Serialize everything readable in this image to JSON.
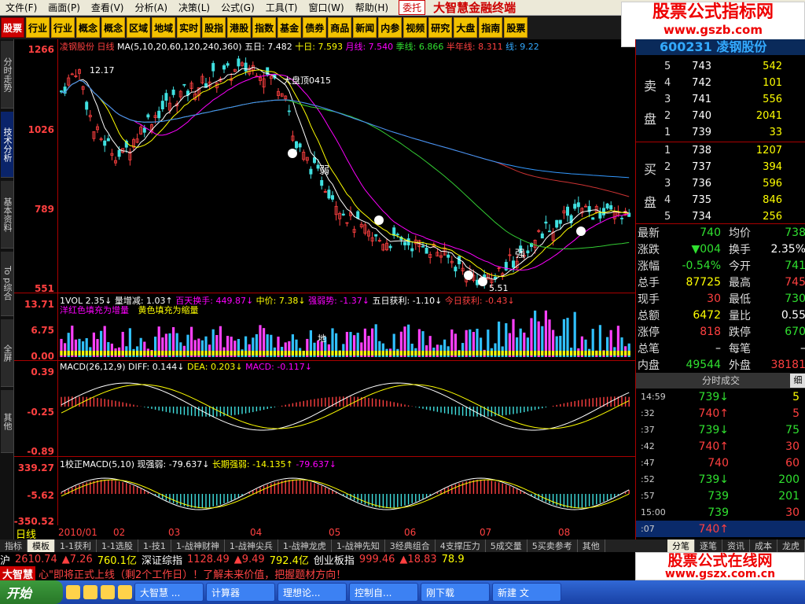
{
  "menu": [
    "文件(F)",
    "画面(P)",
    "查看(V)",
    "分析(A)",
    "决策(L)",
    "公式(G)",
    "工具(T)",
    "窗口(W)",
    "帮助(H)"
  ],
  "delegate": "委托",
  "brand": "大智慧金融终端",
  "toolbar": [
    "股票",
    "行业",
    "行业",
    "概念",
    "概念",
    "区域",
    "地域",
    "实时",
    "股指",
    "港股",
    "指数",
    "基金",
    "债券",
    "商品",
    "新闻",
    "内参",
    "视频",
    "研究",
    "大盘",
    "指南",
    "股票"
  ],
  "watermark": {
    "title": "股票公式指标网",
    "url": "www.gszb.com"
  },
  "watermark2": {
    "title": "股票公式在线网",
    "url": "www.gszx.com.cn"
  },
  "left_tabs": [
    "分时走势",
    "技术分析",
    "基本资料",
    "To p综合",
    "全屏",
    "其他"
  ],
  "stock_title": "凌钢股份 日线",
  "ma_line": {
    "label": "MA(5,10,20,60,120,240,360)",
    "items": [
      "五日: 7.482",
      "十日: 7.593",
      "月线: 7.540",
      "季线: 6.866",
      "半年线: 8.311",
      "线: 9.22"
    ]
  },
  "price_axis": [
    "1266",
    "1026",
    "789",
    "551"
  ],
  "annotations": {
    "peak_left": "12.17",
    "top_label": "大盘顶0415",
    "low_label": "5.51",
    "weak": "弱",
    "strong": "强",
    "di": "地"
  },
  "vol": {
    "title": "1VOL 2.35↓",
    "items": [
      "量增减: 1.03↑",
      "百天换手: 449.87↓",
      "中价: 7.38↓",
      "强弱势: -1.37↓",
      "五日获利: -1.10↓",
      "今日获利: -0.43↓"
    ],
    "legend_red": "洋红色填充为增量",
    "legend_yellow": "黄色填充为缩量",
    "axis": [
      "13.71",
      "6.75",
      "0.00"
    ]
  },
  "macd": {
    "title": "MACD(26,12,9)",
    "items": [
      "DIFF: 0.144↓",
      "DEA: 0.203↓",
      "MACD: -0.117↓"
    ],
    "axis": [
      "0.39",
      "-0.25",
      "-0.89"
    ]
  },
  "cmacd": {
    "title": "1校正MACD(5,10)",
    "items": [
      "现强弱: -79.637↓",
      "长期强弱: -14.135↑",
      "-79.637↓"
    ],
    "axis": [
      "339.27",
      "-5.62",
      "-350.52"
    ]
  },
  "date_axis": {
    "label": "日线",
    "dates": [
      "2010/01",
      "02",
      "03",
      "04",
      "05",
      "06",
      "07",
      "08"
    ]
  },
  "stock_code_header": "600231 凌钢股份",
  "order_book": {
    "ask_label": "卖盘",
    "bid_label": "买盘",
    "asks": [
      {
        "lv": "5",
        "price": "743",
        "vol": "542"
      },
      {
        "lv": "4",
        "price": "742",
        "vol": "101"
      },
      {
        "lv": "3",
        "price": "741",
        "vol": "556"
      },
      {
        "lv": "2",
        "price": "740",
        "vol": "2041"
      },
      {
        "lv": "1",
        "price": "739",
        "vol": "33"
      }
    ],
    "bids": [
      {
        "lv": "1",
        "price": "738",
        "vol": "1207"
      },
      {
        "lv": "2",
        "price": "737",
        "vol": "394"
      },
      {
        "lv": "3",
        "price": "736",
        "vol": "596"
      },
      {
        "lv": "4",
        "price": "735",
        "vol": "846"
      },
      {
        "lv": "5",
        "price": "734",
        "vol": "256"
      }
    ]
  },
  "quote": [
    {
      "k1": "最新",
      "v1": "740",
      "c1": "grn",
      "k2": "均价",
      "v2": "738",
      "c2": "grn"
    },
    {
      "k1": "涨跌",
      "v1": "▼004",
      "c1": "grn",
      "k2": "换手",
      "v2": "2.35%",
      "c2": "wht"
    },
    {
      "k1": "涨幅",
      "v1": "-0.54%",
      "c1": "grn",
      "k2": "今开",
      "v2": "741",
      "c2": "grn"
    },
    {
      "k1": "总手",
      "v1": "87725",
      "c1": "yel",
      "k2": "最高",
      "v2": "745",
      "c2": "red"
    },
    {
      "k1": "现手",
      "v1": "30",
      "c1": "red",
      "k2": "最低",
      "v2": "730",
      "c2": "grn"
    },
    {
      "k1": "总额",
      "v1": "6472",
      "c1": "yel",
      "k2": "量比",
      "v2": "0.55",
      "c2": "wht"
    },
    {
      "k1": "涨停",
      "v1": "818",
      "c1": "red",
      "k2": "跌停",
      "v2": "670",
      "c2": "grn"
    },
    {
      "k1": "总笔",
      "v1": "–",
      "c1": "wht",
      "k2": "每笔",
      "v2": "–",
      "c2": "wht"
    },
    {
      "k1": "内盘",
      "v1": "49544",
      "c1": "grn",
      "k2": "外盘",
      "v2": "38181",
      "c2": "red"
    }
  ],
  "trades_title": "分时成交",
  "trades_detail": "细",
  "trades": [
    {
      "t": "14:59",
      "p": "739↓",
      "pc": "grn",
      "v": "5",
      "vc": "yel"
    },
    {
      "t": ":32",
      "p": "740↑",
      "pc": "red",
      "v": "5",
      "vc": "red"
    },
    {
      "t": ":37",
      "p": "739↓",
      "pc": "grn",
      "v": "75",
      "vc": "grn"
    },
    {
      "t": ":42",
      "p": "740↑",
      "pc": "red",
      "v": "30",
      "vc": "red"
    },
    {
      "t": ":47",
      "p": "740",
      "pc": "red",
      "v": "60",
      "vc": "red"
    },
    {
      "t": ":52",
      "p": "739↓",
      "pc": "grn",
      "v": "200",
      "vc": "grn"
    },
    {
      "t": ":57",
      "p": "739",
      "pc": "grn",
      "v": "201",
      "vc": "grn"
    },
    {
      "t": "15:00",
      "p": "739",
      "pc": "grn",
      "v": "30",
      "vc": "red"
    },
    {
      "t": ":07",
      "p": "740↑",
      "pc": "red",
      "v": "",
      "vc": "red"
    }
  ],
  "bottom_tabs": [
    "指标",
    "模板",
    "1-1获利",
    "1-1选股",
    "1-技1",
    "1-战神财神",
    "1-战神尖兵",
    "1-战神龙虎",
    "1-战神先知",
    "3经典组合",
    "4支撑压力",
    "5成交量",
    "5买卖参考",
    "其他"
  ],
  "right_tabs": [
    "分笔",
    "逐笔",
    "资讯",
    "成本",
    "龙虎"
  ],
  "index_bar": [
    {
      "t": "沪",
      "c": "wht"
    },
    {
      "t": "2610.74",
      "c": "red"
    },
    {
      "t": "▲7.26",
      "c": "red"
    },
    {
      "t": "760.1亿",
      "c": "yel"
    },
    {
      "t": "深证综指",
      "c": "wht"
    },
    {
      "t": "1128.49",
      "c": "red"
    },
    {
      "t": "▲9.49",
      "c": "red"
    },
    {
      "t": "792.4亿",
      "c": "yel"
    },
    {
      "t": "创业板指",
      "c": "wht"
    },
    {
      "t": "999.46",
      "c": "red"
    },
    {
      "t": "▲18.83",
      "c": "red"
    },
    {
      "t": "78.9",
      "c": "yel"
    }
  ],
  "ticker": {
    "logo": "大智慧",
    "text": "心\"即将正式上线（剩2个工作日）！了解未来价值，把握题材方向！"
  },
  "taskbar": {
    "start": "开始",
    "items": [
      "大智慧 ...",
      "计算器",
      "理想论...",
      "控制自...",
      "刚下载",
      "新建 文"
    ]
  },
  "chart_data": {
    "type": "candlestick",
    "title": "凌钢股份 日线",
    "y_range": [
      5.51,
      12.66
    ],
    "price_ticks": [
      12.66,
      10.26,
      7.89,
      5.51
    ],
    "high_label": 12.17,
    "low_label": 5.51,
    "x_categories": [
      "2010/01",
      "02",
      "03",
      "04",
      "05",
      "06",
      "07",
      "08"
    ]
  }
}
